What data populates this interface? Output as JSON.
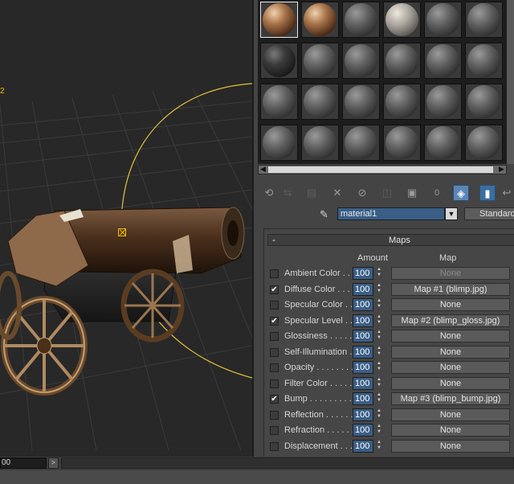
{
  "viewport": {
    "axis_label": "2"
  },
  "material_slots": {
    "rows": [
      [
        {
          "style": "orange-map"
        },
        {
          "style": "orange-map"
        },
        {
          "style": "gray"
        },
        {
          "style": "light"
        },
        {
          "style": "gray"
        },
        {
          "style": "gray"
        }
      ],
      [
        {
          "style": "dark"
        },
        {
          "style": "gray"
        },
        {
          "style": "gray"
        },
        {
          "style": "gray"
        },
        {
          "style": "gray"
        },
        {
          "style": "gray"
        }
      ],
      [
        {
          "style": "gray"
        },
        {
          "style": "gray"
        },
        {
          "style": "gray"
        },
        {
          "style": "gray"
        },
        {
          "style": "gray"
        },
        {
          "style": "gray"
        }
      ],
      [
        {
          "style": "gray"
        },
        {
          "style": "gray"
        },
        {
          "style": "gray"
        },
        {
          "style": "gray"
        },
        {
          "style": "gray"
        },
        {
          "style": "gray"
        }
      ]
    ],
    "selected_index": 0
  },
  "toolbar": {
    "icons": [
      "get-material-icon",
      "put-to-scene-icon",
      "assign-to-selection-icon",
      "reset-map-icon",
      "make-unique-icon",
      "put-to-library-icon",
      "material-id-icon",
      "show-in-viewport-icon",
      "show-end-result-icon",
      "go-to-parent-icon"
    ],
    "id_value": "0"
  },
  "material": {
    "name": "material1",
    "type": "Standard"
  },
  "maps_panel": {
    "title": "Maps",
    "collapse_symbol": "-",
    "amount_header": "Amount",
    "map_header": "Map",
    "rows": [
      {
        "label": "Ambient Color . .",
        "checked": false,
        "amount": "100",
        "map": "None",
        "dim": true
      },
      {
        "label": "Diffuse Color . . . .",
        "checked": true,
        "amount": "100",
        "map": "Map #1 (blimp.jpg)",
        "dim": false
      },
      {
        "label": "Specular Color . .",
        "checked": false,
        "amount": "100",
        "map": "None",
        "dim": false
      },
      {
        "label": "Specular Level . .",
        "checked": true,
        "amount": "100",
        "map": "Map #2 (blimp_gloss.jpg)",
        "dim": false
      },
      {
        "label": "Glossiness . . . . .",
        "checked": false,
        "amount": "100",
        "map": "None",
        "dim": false
      },
      {
        "label": "Self-Illumination .",
        "checked": false,
        "amount": "100",
        "map": "None",
        "dim": false
      },
      {
        "label": "Opacity . . . . . . . .",
        "checked": false,
        "amount": "100",
        "map": "None",
        "dim": false
      },
      {
        "label": "Filter Color . . . . .",
        "checked": false,
        "amount": "100",
        "map": "None",
        "dim": false
      },
      {
        "label": "Bump . . . . . . . . . .",
        "checked": true,
        "amount": "100",
        "map": "Map #3 (blimp_bump.jpg)",
        "dim": false
      },
      {
        "label": "Reflection . . . . . .",
        "checked": false,
        "amount": "100",
        "map": "None",
        "dim": false
      },
      {
        "label": "Refraction . . . . . .",
        "checked": false,
        "amount": "100",
        "map": "None",
        "dim": false
      },
      {
        "label": "Displacement . . . .",
        "checked": false,
        "amount": "100",
        "map": "None",
        "dim": false
      }
    ]
  },
  "statusbar": {
    "frame_field": "00",
    "arrow": ">"
  },
  "colors": {
    "accent_blue": "#3a5e86",
    "gizmo_yellow": "#f0c000"
  }
}
